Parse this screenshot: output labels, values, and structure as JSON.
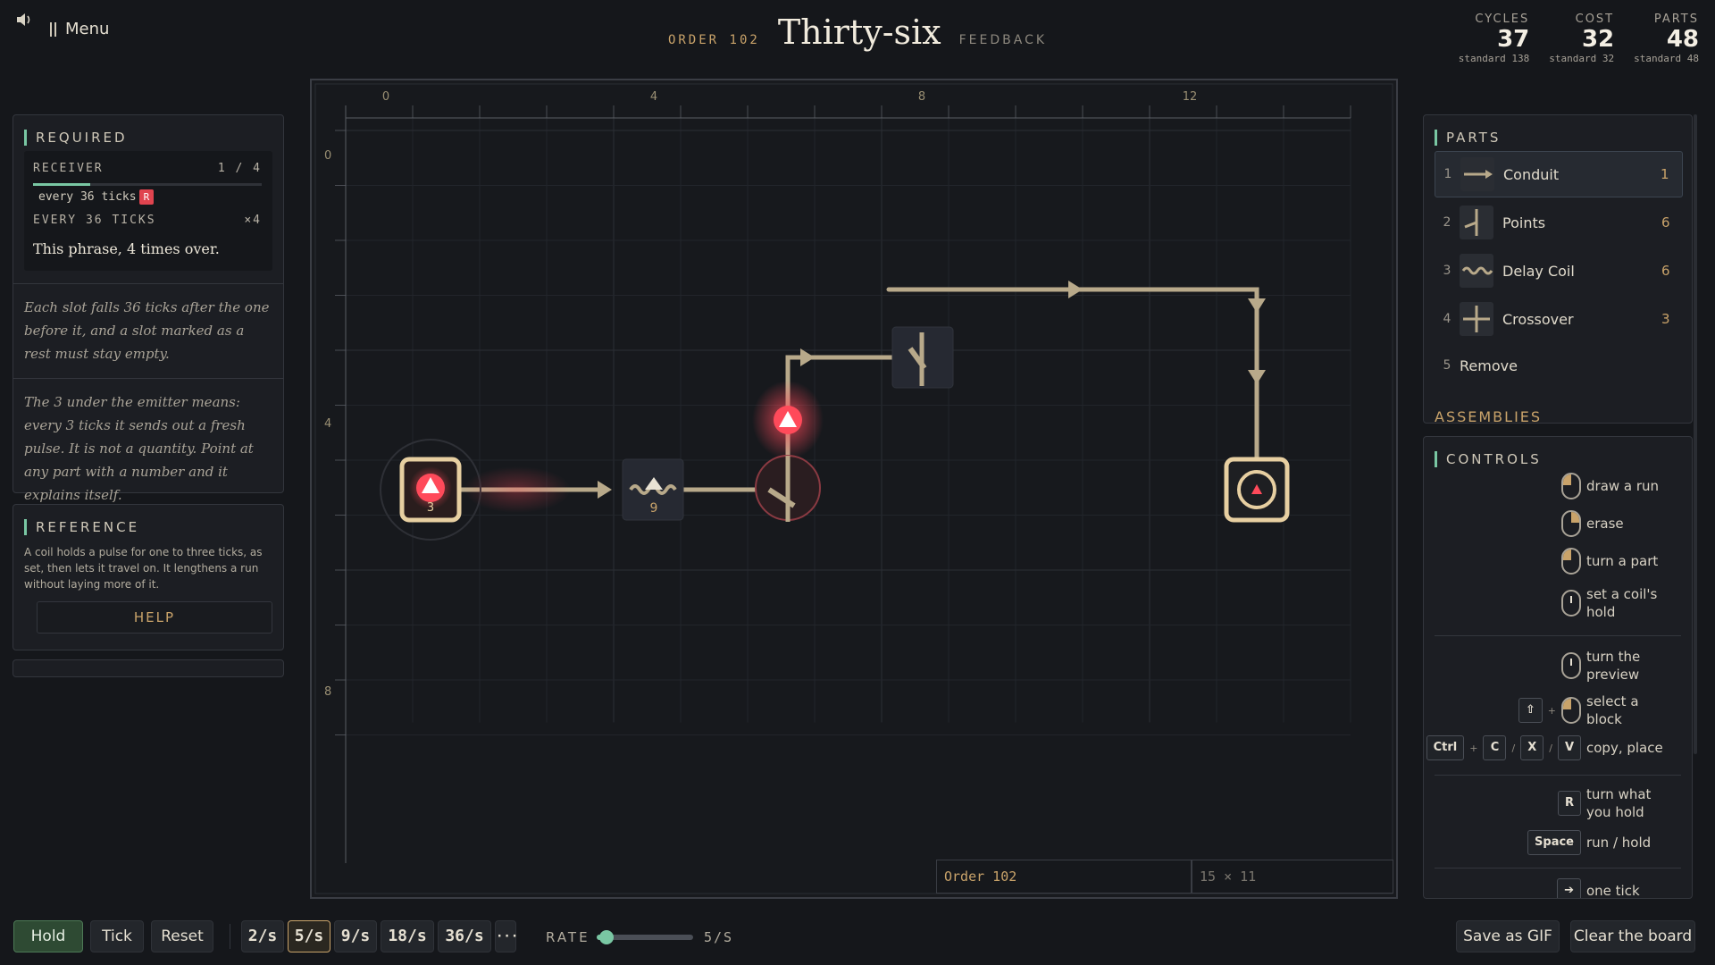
{
  "header": {
    "menu_label": "Menu",
    "order_label": "ORDER 102",
    "title": "Thirty-six",
    "feedback_label": "FEEDBACK",
    "icons": {
      "sound": "speaker-icon",
      "menu": "pause-bars-icon"
    }
  },
  "stats": [
    {
      "label": "CYCLES",
      "value": "37",
      "standard": "standard 138"
    },
    {
      "label": "COST",
      "value": "32",
      "standard": "standard 32"
    },
    {
      "label": "PARTS",
      "value": "48",
      "standard": "standard 48"
    }
  ],
  "required": {
    "heading": "REQUIRED",
    "receiver_label": "RECEIVER",
    "receiver_progress_text": "1 / 4",
    "receiver_progress_fraction": 0.25,
    "every_ticks": "every 36 ticks",
    "badge": "R",
    "every_heading": "EVERY 36 TICKS",
    "times": "×4",
    "phrase": "This phrase, 4 times over.",
    "note1": "Each slot falls 36 ticks after the one before it, and a slot marked as a rest must stay empty.",
    "note2": "The 3 under the emitter means: every 3 ticks it sends out a fresh pulse. It is not a quantity. Point at any part with a number and it explains itself."
  },
  "reference": {
    "heading": "REFERENCE",
    "text": "A coil holds a pulse for one to three ticks, as set, then lets it travel on. It lengthens a run without laying more of it.",
    "help_label": "HELP"
  },
  "board": {
    "col_labels": [
      "0",
      "4",
      "8",
      "12"
    ],
    "row_labels": [
      "0",
      "4",
      "8"
    ],
    "emitter_number": "3",
    "coil_number": "9",
    "status_order": "Order 102",
    "status_size": "15 × 11",
    "accent_red": "#ff4a5a",
    "wire_color": "#b8a98a"
  },
  "parts": {
    "heading": "PARTS",
    "items": [
      {
        "key": "1",
        "name": "Conduit",
        "count": "1",
        "icon": "conduit-icon"
      },
      {
        "key": "2",
        "name": "Points",
        "count": "6",
        "icon": "points-icon"
      },
      {
        "key": "3",
        "name": "Delay Coil",
        "count": "6",
        "icon": "delay-coil-icon"
      },
      {
        "key": "4",
        "name": "Crossover",
        "count": "3",
        "icon": "crossover-icon"
      },
      {
        "key": "5",
        "name": "Remove",
        "count": "",
        "icon": ""
      }
    ],
    "assemblies": "ASSEMBLIES"
  },
  "controls": {
    "heading": "CONTROLS",
    "draw": "draw a run",
    "erase": "erase",
    "turn_part": "turn a part",
    "coil_hold": "set a coil's hold",
    "turn_preview": "turn the preview",
    "select_block": "select a block",
    "copy_place": "copy, place",
    "turn_hold": "turn what you hold",
    "run_hold": "run / hold",
    "one_tick": "one tick",
    "keys": {
      "shift": "⇧",
      "ctrl": "Ctrl",
      "c": "C",
      "x": "X",
      "v": "V",
      "r": "R",
      "space": "Space",
      "arrow": "➔",
      "slash": "/",
      "plus": "+"
    }
  },
  "bottom": {
    "hold": "Hold",
    "tick": "Tick",
    "reset": "Reset",
    "speeds": [
      "2/s",
      "5/s",
      "9/s",
      "18/s",
      "36/s"
    ],
    "more": "···",
    "rate_label": "RATE",
    "rate_value": "5/S",
    "rate_fraction": 0.1,
    "save_gif": "Save as GIF",
    "clear": "Clear the board"
  }
}
